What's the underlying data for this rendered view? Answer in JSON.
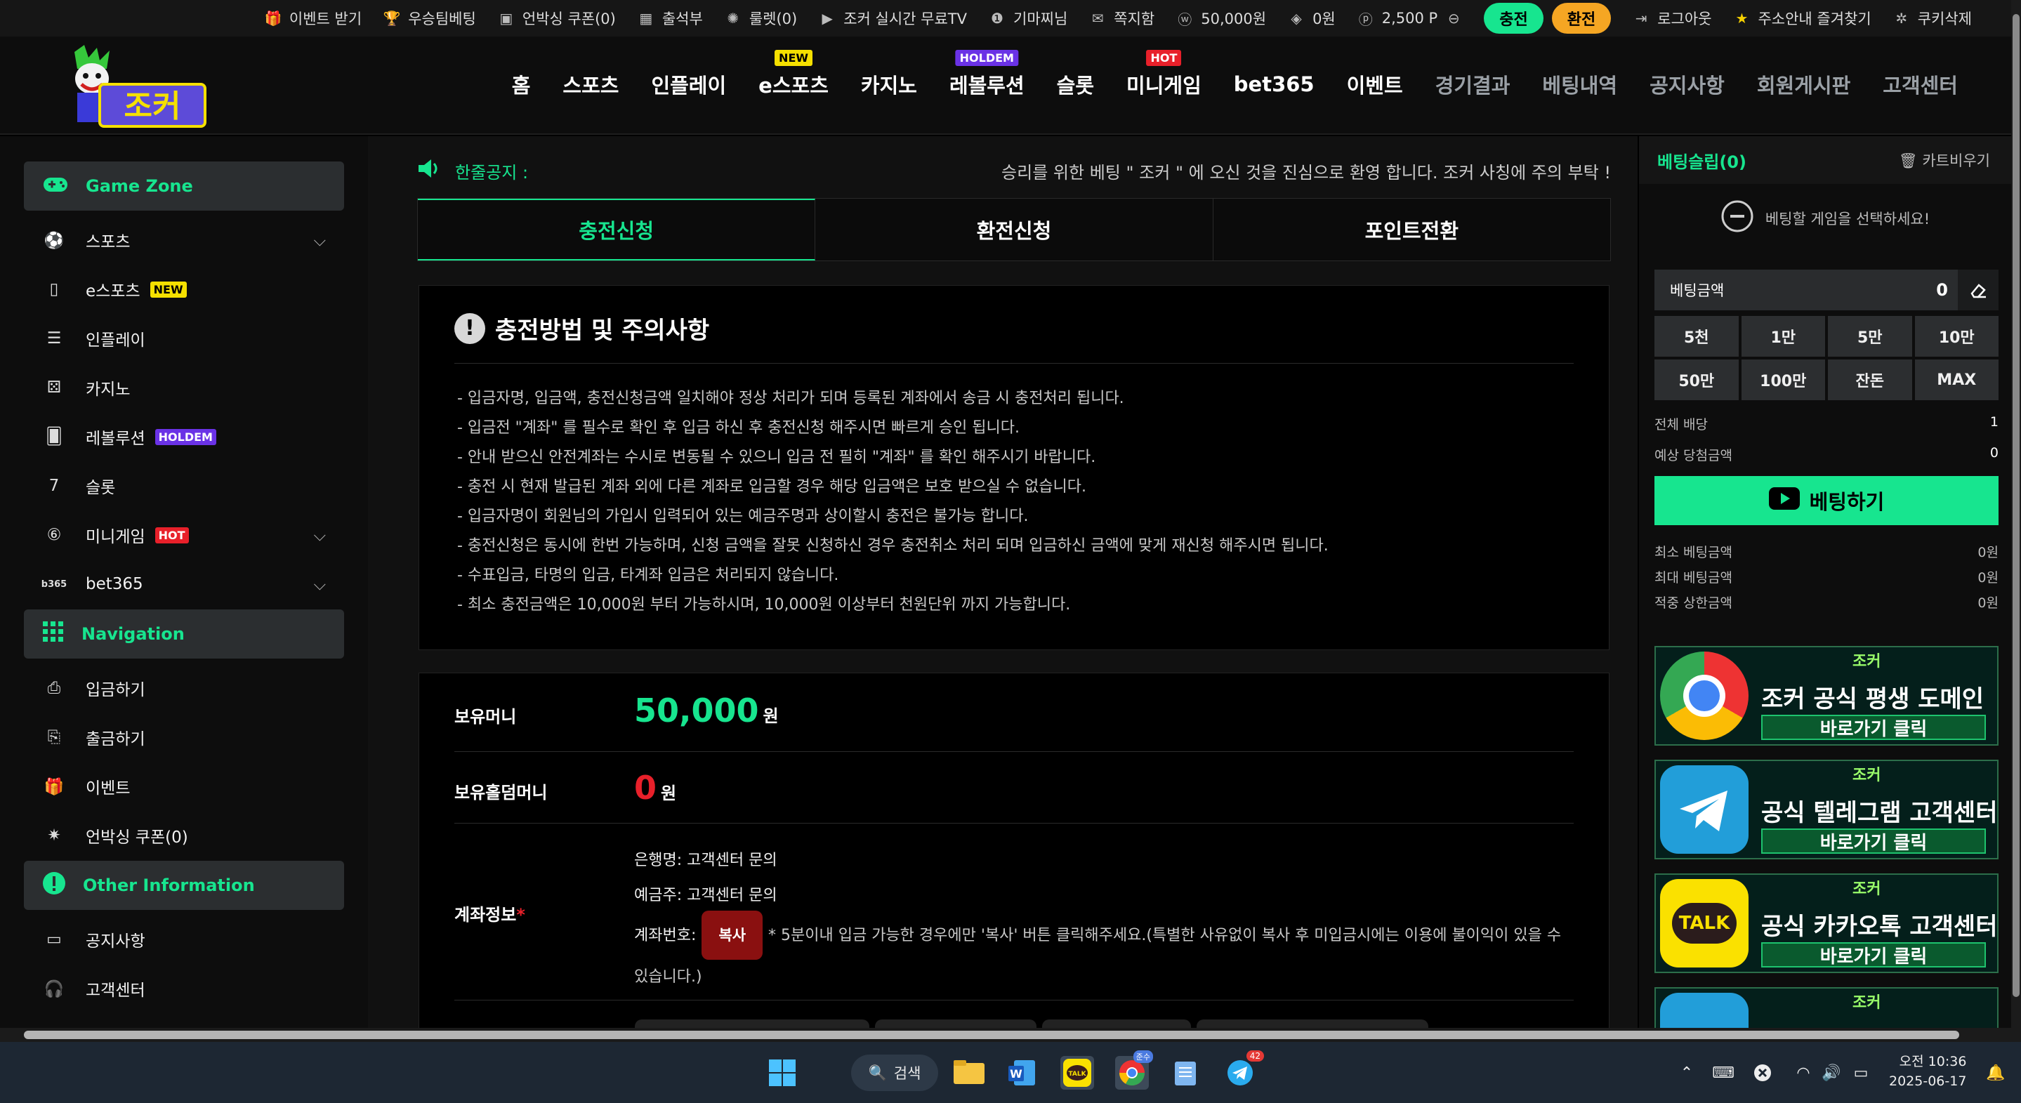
{
  "topbar": {
    "items": [
      {
        "label": "이벤트 받기",
        "icon": "gift-icon"
      },
      {
        "label": "우승팀베팅",
        "icon": "trophy-icon"
      },
      {
        "label": "언박싱 쿠폰(0)",
        "icon": "box-icon"
      },
      {
        "label": "출석부",
        "icon": "calendar-icon"
      },
      {
        "label": "룰렛(0)",
        "icon": "roulette-icon"
      },
      {
        "label": "조커 실시간 무료TV",
        "icon": "youtube-icon"
      },
      {
        "label": "기마찌님",
        "icon": "level-icon"
      },
      {
        "label": "쪽지함",
        "icon": "mail-icon"
      },
      {
        "label": "50,000원",
        "icon": "won-coin-icon"
      },
      {
        "label": "0원",
        "icon": "casino-chip-icon"
      },
      {
        "label": "2,500 P",
        "icon": "point-coin-icon"
      }
    ],
    "deposit_label": "충전",
    "withdraw_label": "환전",
    "logout_label": "로그아웃",
    "bookmark_label": "주소안내 즐겨찾기",
    "cookie_label": "쿠키삭제"
  },
  "header": {
    "logo_text": "조커",
    "nav": [
      {
        "label": "홈",
        "badge": ""
      },
      {
        "label": "스포츠",
        "badge": ""
      },
      {
        "label": "인플레이",
        "badge": ""
      },
      {
        "label": "e스포츠",
        "badge": "NEW"
      },
      {
        "label": "카지노",
        "badge": ""
      },
      {
        "label": "레볼루션",
        "badge": "HOLDEM"
      },
      {
        "label": "슬롯",
        "badge": ""
      },
      {
        "label": "미니게임",
        "badge": "HOT"
      },
      {
        "label": "bet365",
        "badge": ""
      },
      {
        "label": "이벤트",
        "badge": ""
      },
      {
        "label": "경기결과",
        "badge": ""
      },
      {
        "label": "베팅내역",
        "badge": ""
      },
      {
        "label": "공지사항",
        "badge": ""
      },
      {
        "label": "회원게시판",
        "badge": ""
      },
      {
        "label": "고객센터",
        "badge": ""
      }
    ]
  },
  "sidebar": {
    "game_zone": "Game Zone",
    "games": [
      {
        "label": "스포츠",
        "badge": ""
      },
      {
        "label": "e스포츠",
        "badge": "NEW"
      },
      {
        "label": "인플레이",
        "badge": ""
      },
      {
        "label": "카지노",
        "badge": ""
      },
      {
        "label": "레볼루션",
        "badge": "HOLDEM"
      },
      {
        "label": "슬롯",
        "badge": ""
      },
      {
        "label": "미니게임",
        "badge": "HOT"
      },
      {
        "label": "bet365",
        "badge": ""
      }
    ],
    "navigation": "Navigation",
    "nav_items": [
      "입금하기",
      "출금하기",
      "이벤트",
      "언박싱 쿠폰(0)"
    ],
    "other": "Other Information",
    "other_items": [
      "공지사항",
      "고객센터"
    ]
  },
  "notice": {
    "label": "한줄공지 :",
    "text": "승리를 위한 베팅 \" 조커 \" 에 오신 것을 진심으로 환영 합니다. 조커 사칭에 주의 부탁 !"
  },
  "tabs": [
    "충전신청",
    "환전신청",
    "포인트전환"
  ],
  "guide": {
    "title": "충전방법 및 주의사항",
    "items": [
      "- 입금자명, 입금액, 충전신청금액 일치해야 정상 처리가 되며 등록된 계좌에서 송금 시 충전처리 됩니다.",
      "- 입금전 \"계좌\" 를 필수로 확인 후 입금 하신 후 충전신청 해주시면 빠르게 승인 됩니다.",
      "- 안내 받으신 안전계좌는 수시로 변동될 수 있으니 입금 전 필히 \"계좌\" 를 확인 해주시기 바랍니다.",
      "- 충전 시 현재 발급된 계좌 외에 다른 계좌로 입금할 경우 해당 입금액은 보호 받으실 수 없습니다.",
      "- 입금자명이 회원님의 가입시 입력되어 있는 예금주명과 상이할시 충전은 불가능 합니다.",
      "- 충전신청은 동시에 한번 가능하며, 신청 금액을 잘못 신청하신 경우 충전취소 처리 되며 입금하신 금액에 맞게 재신청 해주시면 됩니다.",
      "- 수표입금, 타명의 입금, 타계좌 입금은 처리되지 않습니다.",
      "- 최소 충전금액은 10,000원 부터 가능하시며, 10,000원 이상부터 천원단위 까지 가능합니다."
    ]
  },
  "wallet": {
    "money_label": "보유머니",
    "money_value": "50,000",
    "holdem_label": "보유홀덤머니",
    "holdem_value": "0",
    "won": "원",
    "account_label": "계좌정보",
    "required_mark": "*",
    "bank_line": "은행명: 고객센터 문의",
    "holder_line": "예금주: 고객센터 문의",
    "number_label": "계좌번호:",
    "copy_label": "복사",
    "note": "* 5분이내 입금 가능한 경우에만 '복사' 버튼 클릭해주세요.(특별한 사유없이 복사 후 미입금시에는 이용에 불이익이 있을 수 있습니다.)"
  },
  "betslip": {
    "title": "베팅슬립(0)",
    "clear_label": "카트비우기",
    "empty_msg": "베팅할 게임을 선택하세요!",
    "amount_label": "베팅금액",
    "amount_value": "0",
    "amount_buttons": [
      "5천",
      "1만",
      "5만",
      "10만",
      "50만",
      "100만",
      "잔돈",
      "MAX"
    ],
    "total_odds_label": "전체 배당",
    "total_odds_value": "1",
    "expected_label": "예상 당첨금액",
    "expected_value": "0",
    "bet_button": "베팅하기",
    "min_label": "최소 베팅금액",
    "min_value": "0원",
    "max_label": "최대 베팅금액",
    "max_value": "0원",
    "limit_label": "적중 상한금액",
    "limit_value": "0원",
    "banners": [
      {
        "logo": "조커",
        "main": "조커 공식 평생 도메인",
        "sub": "바로가기 클릭",
        "icon": "chrome-icon"
      },
      {
        "logo": "조커",
        "main": "공식 텔레그램 고객센터",
        "sub": "바로가기 클릭",
        "icon": "telegram-icon"
      },
      {
        "logo": "조커",
        "main": "공식 카카오톡 고객센터",
        "sub": "바로가기 클릭",
        "icon": "kakaotalk-icon",
        "icon_text": "TALK"
      },
      {
        "logo": "조커",
        "main": "",
        "sub": "",
        "icon": "blue-app-icon"
      }
    ]
  },
  "taskbar": {
    "search_label": "검색",
    "chrome_badge": "준수",
    "telegram_badge": "42",
    "time": "오전 10:36",
    "date": "2025-06-17"
  },
  "colors": {
    "accent": "#17e58f",
    "deposit": "#17e58f",
    "withdraw": "#f5a623",
    "hot": "#e8202a",
    "new": "#f5e000",
    "holdem": "#6a32e6"
  }
}
